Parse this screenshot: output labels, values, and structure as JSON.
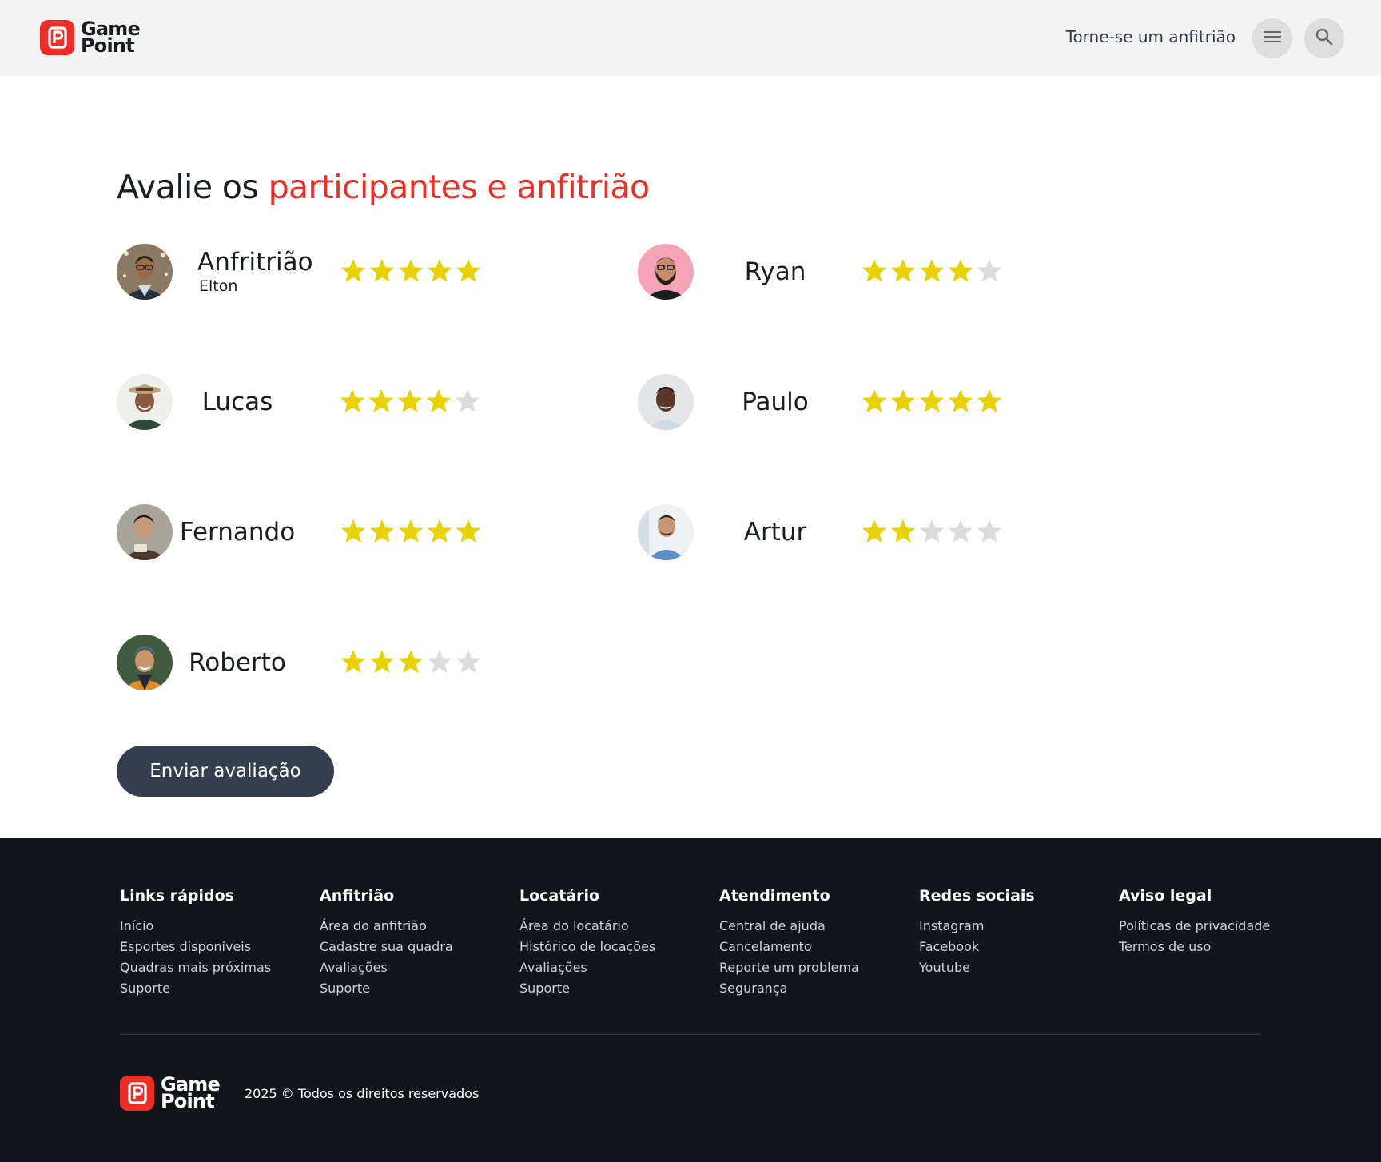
{
  "header": {
    "logo": {
      "line1": "Game",
      "line2": "Point"
    },
    "host_link": "Torne-se um anfitrião",
    "menu_icon": "hamburger-menu-icon",
    "search_icon": "search-icon"
  },
  "main": {
    "title_prefix": "Avalie os ",
    "title_accent": "participantes e anfitrião",
    "people": [
      {
        "name": "Anfritrião",
        "subtitle": "Elton",
        "rating": 5
      },
      {
        "name": "Ryan",
        "rating": 4
      },
      {
        "name": "Lucas",
        "rating": 4
      },
      {
        "name": "Paulo",
        "rating": 5
      },
      {
        "name": "Fernando",
        "rating": 5
      },
      {
        "name": "Artur",
        "rating": 2
      },
      {
        "name": "Roberto",
        "rating": 3
      }
    ],
    "max_rating": 5,
    "submit_label": "Enviar avaliação"
  },
  "colors": {
    "accent": "#ee2e26",
    "star_filled": "#e8d200",
    "star_empty": "#dcdcdc",
    "button": "#353d4f",
    "footer_bg": "#121519"
  },
  "footer": {
    "columns": [
      {
        "title": "Links rápidos",
        "links": [
          "Início",
          "Esportes disponíveis",
          "Quadras mais próximas",
          "Suporte"
        ]
      },
      {
        "title": "Anfitrião",
        "links": [
          "Área do anfitrião",
          "Cadastre sua quadra",
          "Avaliações",
          "Suporte"
        ]
      },
      {
        "title": "Locatário",
        "links": [
          "Área do locatário",
          "Histórico de locações",
          "Avaliações",
          "Suporte"
        ]
      },
      {
        "title": "Atendimento",
        "links": [
          "Central de ajuda",
          "Cancelamento",
          "Reporte um problema",
          "Segurança"
        ]
      },
      {
        "title": "Redes sociais",
        "links": [
          "Instagram",
          "Facebook",
          "Youtube"
        ]
      },
      {
        "title": "Aviso legal",
        "links": [
          "Políticas de privacidade",
          "Termos de uso"
        ]
      }
    ],
    "logo": {
      "line1": "Game",
      "line2": "Point"
    },
    "copyright": "2025 © Todos os direitos reservados"
  }
}
